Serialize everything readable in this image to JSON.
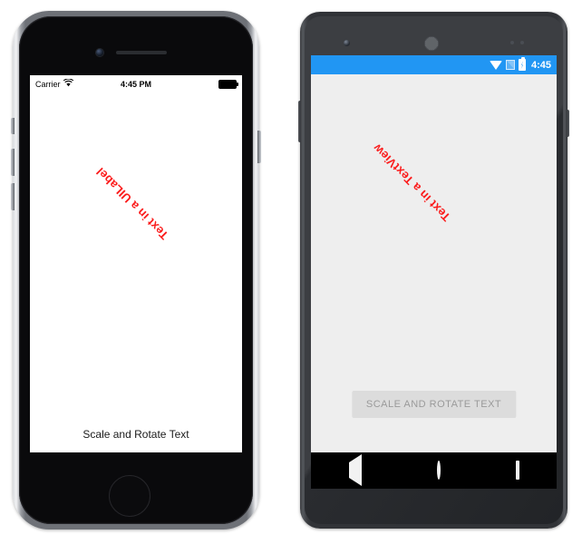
{
  "ios": {
    "device_name": "iphone-device",
    "status_bar": {
      "carrier": "Carrier",
      "wifi_icon": "wifi-icon",
      "time": "4:45 PM",
      "battery_icon": "battery-icon"
    },
    "screen": {
      "background_color": "#ffffff",
      "rotated_label": {
        "text": "Text in a UILabel",
        "color": "#fb1b1b",
        "rotation_degrees": 225
      },
      "button": {
        "label": "Scale and Rotate Text",
        "text_color": "#1b1b1b"
      }
    },
    "hardware": {
      "camera_icon": "front-camera-icon",
      "speaker_icon": "earpiece-speaker-icon",
      "home_button": "home-button"
    }
  },
  "android": {
    "device_name": "android-device",
    "status_bar": {
      "background_color": "#2196f3",
      "wifi_icon": "wifi-icon",
      "signal_icon": "signal-icon",
      "battery_icon": "battery-charging-icon",
      "time": "4:45"
    },
    "screen": {
      "background_color": "#eeeeee",
      "rotated_label": {
        "text": "Text in a TextView",
        "color": "#fb1b1b",
        "rotation_degrees": 225
      },
      "button": {
        "label": "SCALE AND ROTATE TEXT",
        "background_color": "#dcdcdc",
        "text_color": "#9a9a9a"
      }
    },
    "nav_bar": {
      "background_color": "#000000",
      "back_label": "back-button",
      "home_label": "home-button",
      "recents_label": "recents-button"
    },
    "hardware": {
      "camera_icon": "front-camera-icon",
      "speaker_icon": "earpiece-speaker-icon",
      "sensor_icon": "proximity-sensor-icon"
    }
  }
}
